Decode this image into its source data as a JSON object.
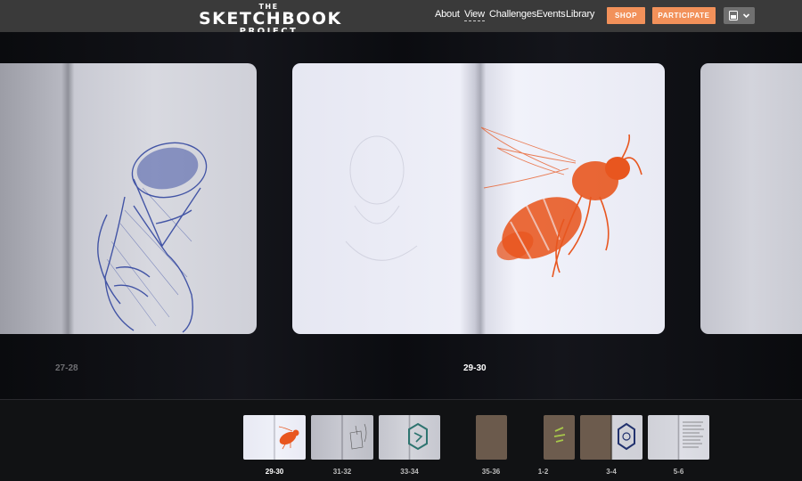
{
  "logo": {
    "the": "THE",
    "main": "SKETCHBOOK",
    "sub": "PROJECT"
  },
  "nav": [
    {
      "label": "About"
    },
    {
      "label": "View"
    },
    {
      "label": "Challenges"
    },
    {
      "label": "Events"
    },
    {
      "label": "Library"
    }
  ],
  "buttons": {
    "shop": "SHOP",
    "participate": "PARTICIPATE"
  },
  "icons": {
    "cart": "shopping-cart-icon",
    "dropdown": "chevron-down-icon"
  },
  "spreads": {
    "left_label": "27-28",
    "center_label": "29-30"
  },
  "thumbnails": [
    {
      "label": "29-30"
    },
    {
      "label": "31-32"
    },
    {
      "label": "33-34"
    },
    {
      "label": "35-36"
    },
    {
      "label": "1-2"
    },
    {
      "label": "3-4"
    },
    {
      "label": "5-6"
    }
  ],
  "colors": {
    "accent": "#f2915a",
    "header": "#3a3a3a",
    "bee": "#e8561f",
    "ink_blue": "#2a3f9c"
  }
}
